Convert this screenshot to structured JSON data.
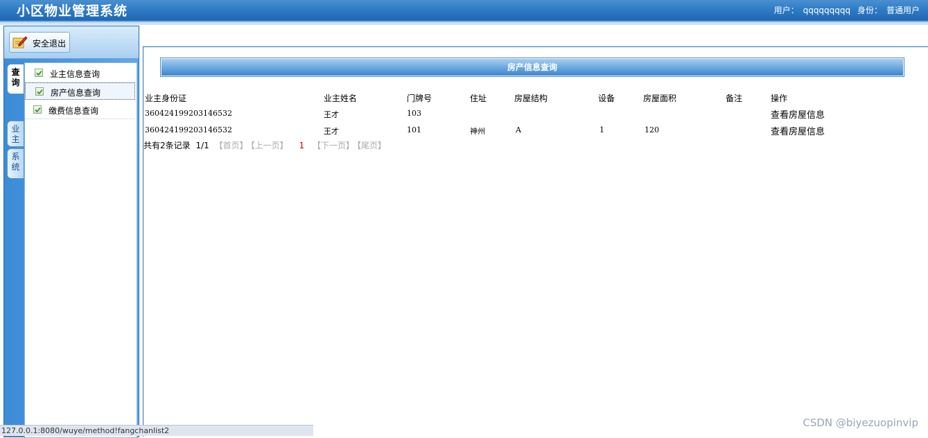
{
  "header": {
    "title": "小区物业管理系统",
    "user_label": "用户：",
    "user_name": "qqqqqqqqq",
    "role_label": "身份：",
    "role": "普通用户"
  },
  "sidebar": {
    "logout_label": "安全退出",
    "tabs": [
      {
        "label": "查询",
        "active": true
      },
      {
        "label": "业主",
        "active": false
      },
      {
        "label": "系统",
        "active": false
      }
    ],
    "menu": [
      {
        "label": "业主信息查询"
      },
      {
        "label": "房产信息查询",
        "selected": true
      },
      {
        "label": "缴费信息查询"
      }
    ]
  },
  "main": {
    "section_title": "房产信息查询",
    "columns": [
      "业主身份证",
      "业主姓名",
      "门牌号",
      "住址",
      "房屋结构",
      "设备",
      "房屋面积",
      "备注",
      "操作"
    ],
    "rows": [
      [
        "360424199203146532",
        "王才",
        "103",
        "",
        "",
        "",
        "",
        "",
        "查看房屋信息"
      ],
      [
        "360424199203146532",
        "王才",
        "101",
        "神州",
        "A",
        "1",
        "120",
        "",
        "查看房屋信息"
      ]
    ],
    "pager": {
      "total": "共有2条记录",
      "page": "1/1",
      "first": "【首页】",
      "prev": "【上一页】",
      "current": "1",
      "next": "【下一页】",
      "last": "【尾页】"
    }
  },
  "status_bar": {
    "url": "127.0.0.1:8080/wuye/method!fangchanlist2"
  },
  "watermark": "CSDN @biyezuopinvip",
  "colors": {
    "header_blue": "#2f7cc6",
    "pager_current": "#cc0000"
  }
}
